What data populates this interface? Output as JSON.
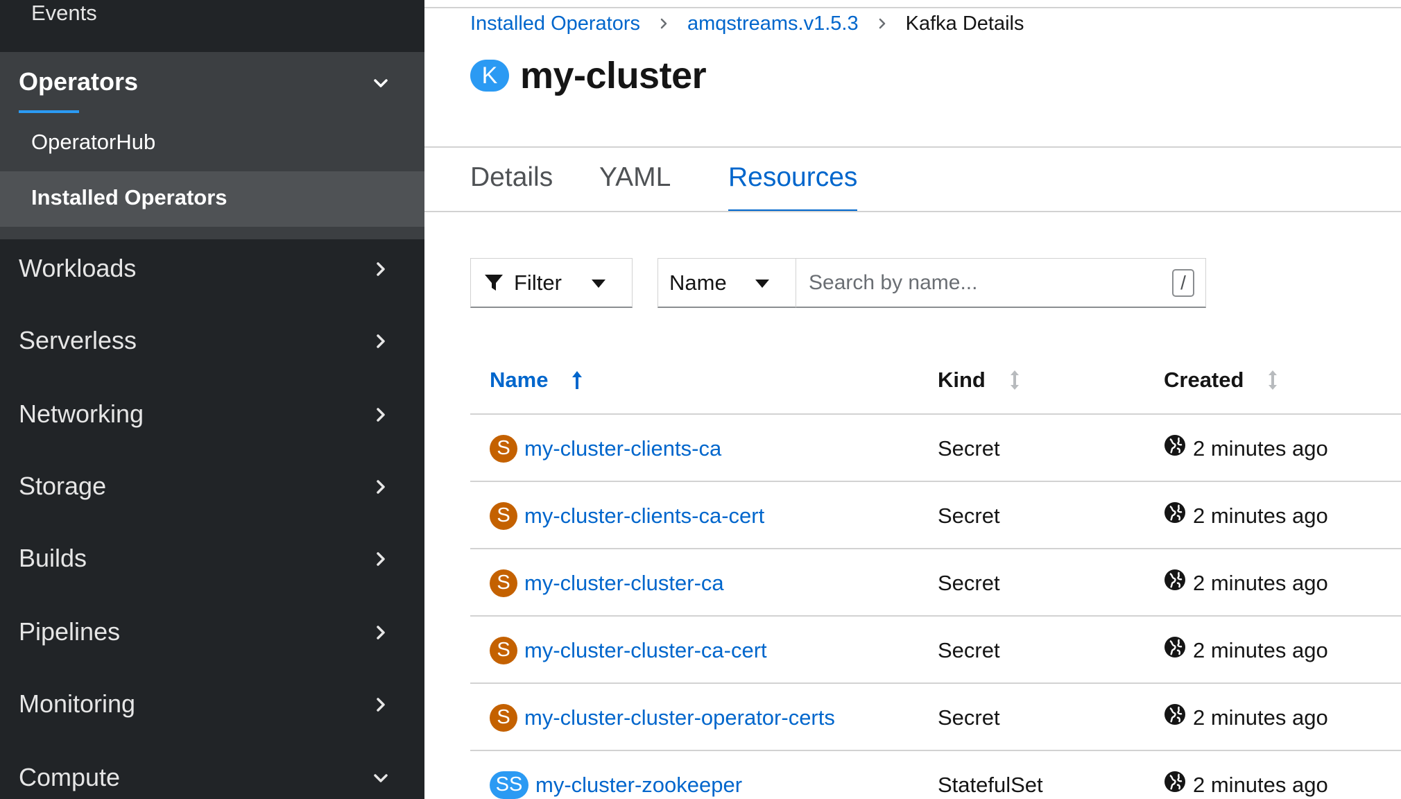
{
  "sidebar": {
    "events_label": "Events",
    "operators": {
      "label": "Operators",
      "items": [
        {
          "label": "OperatorHub"
        },
        {
          "label": "Installed Operators"
        }
      ]
    },
    "sections": [
      {
        "label": "Workloads",
        "chevron": "right"
      },
      {
        "label": "Serverless",
        "chevron": "right"
      },
      {
        "label": "Networking",
        "chevron": "right"
      },
      {
        "label": "Storage",
        "chevron": "right"
      },
      {
        "label": "Builds",
        "chevron": "right"
      },
      {
        "label": "Pipelines",
        "chevron": "right"
      },
      {
        "label": "Monitoring",
        "chevron": "right"
      },
      {
        "label": "Compute",
        "chevron": "down"
      }
    ]
  },
  "breadcrumb": {
    "items": [
      {
        "label": "Installed Operators"
      },
      {
        "label": "amqstreams.v1.5.3"
      },
      {
        "label": "Kafka Details"
      }
    ]
  },
  "page": {
    "badge": "K",
    "title": "my-cluster"
  },
  "tabs": [
    {
      "label": "Details"
    },
    {
      "label": "YAML"
    },
    {
      "label": "Resources"
    }
  ],
  "toolbar": {
    "filter_label": "Filter",
    "select_label": "Name",
    "search_placeholder": "Search by name...",
    "search_shortcut": "/"
  },
  "table": {
    "columns": [
      {
        "label": "Name"
      },
      {
        "label": "Kind"
      },
      {
        "label": "Created"
      }
    ],
    "rows": [
      {
        "badge": "S",
        "name": "my-cluster-clients-ca",
        "kind": "Secret",
        "created": "2 minutes ago"
      },
      {
        "badge": "S",
        "name": "my-cluster-clients-ca-cert",
        "kind": "Secret",
        "created": "2 minutes ago"
      },
      {
        "badge": "S",
        "name": "my-cluster-cluster-ca",
        "kind": "Secret",
        "created": "2 minutes ago"
      },
      {
        "badge": "S",
        "name": "my-cluster-cluster-ca-cert",
        "kind": "Secret",
        "created": "2 minutes ago"
      },
      {
        "badge": "S",
        "name": "my-cluster-cluster-operator-certs",
        "kind": "Secret",
        "created": "2 minutes ago"
      },
      {
        "badge": "SS",
        "name": "my-cluster-zookeeper",
        "kind": "StatefulSet",
        "created": "2 minutes ago"
      }
    ]
  },
  "colors": {
    "sidebar_bg": "#212427",
    "accent_blue": "#0066cc",
    "secret_badge": "#c46100",
    "statefulset_badge": "#2b9af3"
  }
}
